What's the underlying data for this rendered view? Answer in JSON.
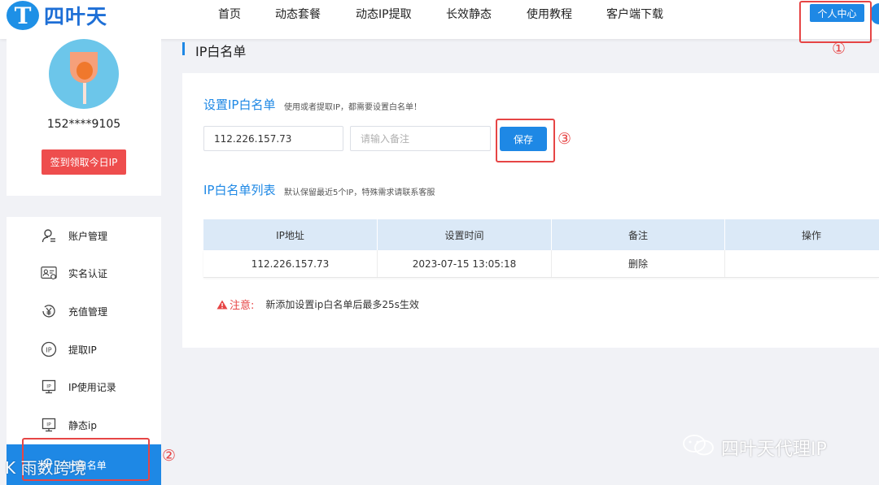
{
  "header": {
    "logo_letter": "T",
    "logo_text": "四叶天",
    "nav": [
      "首页",
      "动态套餐",
      "动态IP提取",
      "长效静态",
      "使用教程",
      "客户端下载"
    ],
    "user_center": "个人中心"
  },
  "annotations": {
    "marker1": "①",
    "marker2": "②",
    "marker3": "③"
  },
  "sidebar": {
    "phone": "152****9105",
    "sign_button": "签到领取今日IP",
    "menu": [
      {
        "label": "账户管理",
        "icon": "user-icon"
      },
      {
        "label": "实名认证",
        "icon": "id-card-icon"
      },
      {
        "label": "充值管理",
        "icon": "yen-icon"
      },
      {
        "label": "提取IP",
        "icon": "ip-circle-icon"
      },
      {
        "label": "IP使用记录",
        "icon": "ip-monitor-icon"
      },
      {
        "label": "静态ip",
        "icon": "ip-monitor-icon"
      },
      {
        "label": "IP白名单",
        "icon": "user-icon",
        "active": true
      }
    ]
  },
  "page": {
    "title": "IP白名单"
  },
  "whitelist": {
    "section_title": "设置IP白名单",
    "section_sub": "使用或者提取IP，都需要设置白名单！",
    "ip_value": "112.226.157.73",
    "remark_placeholder": "请输入备注",
    "save_label": "保存",
    "list_title": "IP白名单列表",
    "list_sub": "默认保留最近5个IP，特殊需求请联系客服",
    "columns": [
      "IP地址",
      "设置时间",
      "备注",
      "操作"
    ],
    "rows": [
      {
        "ip": "112.226.157.73",
        "time": "2023-07-15 13:05:18",
        "remark": "删除",
        "action": ""
      }
    ],
    "note_label": "注意:",
    "note_text": "新添加设置ip白名单后最多25s生效"
  },
  "watermarks": {
    "right": "四叶天代理IP",
    "left": "K 雨数跨境"
  },
  "colors": {
    "primary": "#1e88e5",
    "danger": "#e64545",
    "table_header": "#dbe9f7"
  }
}
